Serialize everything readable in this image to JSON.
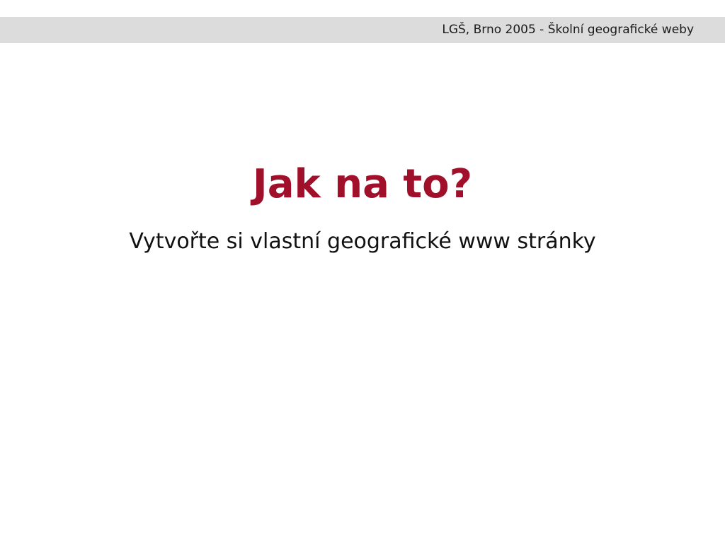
{
  "header": {
    "text": "LGŠ, Brno 2005 - Školní geografické weby"
  },
  "slide": {
    "title": "Jak na to?",
    "subtitle": "Vytvořte si vlastní geografické www stránky"
  },
  "colors": {
    "title": "#a0102a",
    "header_bar": "#dcdcdc",
    "text": "#111111",
    "background": "#ffffff"
  }
}
